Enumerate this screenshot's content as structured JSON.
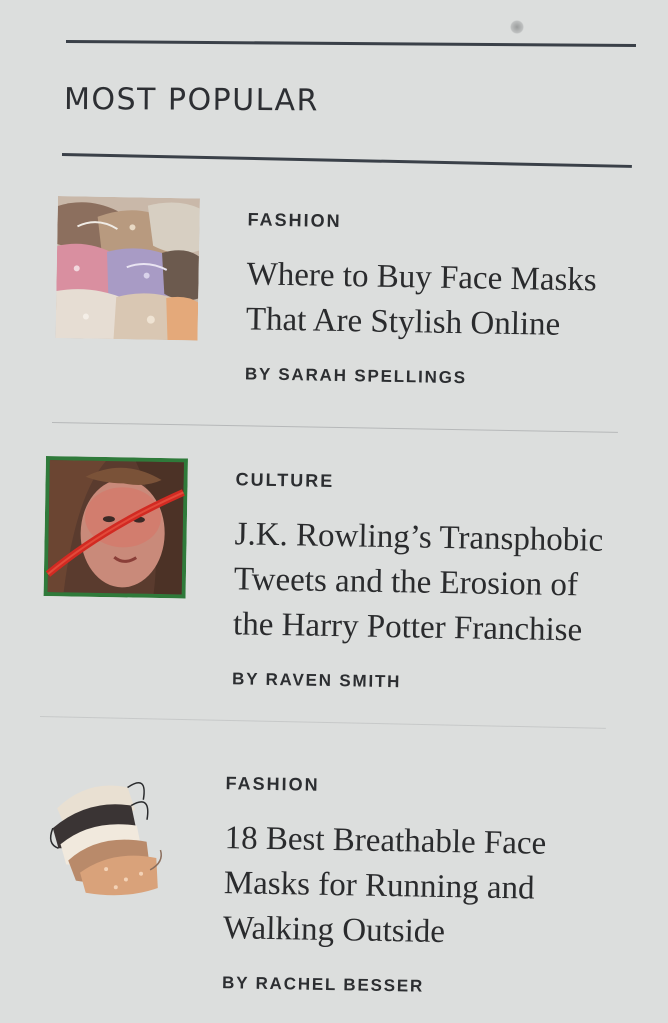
{
  "section": {
    "title": "MOST POPULAR"
  },
  "articles": [
    {
      "category": "FASHION",
      "headline": "Where to Buy Face Masks That Are Stylish Online",
      "byline": "BY SARAH SPELLINGS",
      "thumbnail_icon": "fabric-face-masks-pile-image"
    },
    {
      "category": "CULTURE",
      "headline": "J.K. Rowling’s Transphobic Tweets and the Erosion of the Harry Potter Franchise",
      "byline": "BY RAVEN SMITH",
      "thumbnail_icon": "portrait-with-red-slash-image"
    },
    {
      "category": "FASHION",
      "headline": "18 Best Breathable Face Masks for Running and Walking Outside",
      "byline": "BY RACHEL BESSER",
      "thumbnail_icon": "stacked-face-masks-image"
    }
  ],
  "colors": {
    "background": "#dcdedd",
    "text": "#2a2b2d",
    "rule": "#3a4048",
    "accent_red": "#d22a22",
    "accent_green": "#2e7d32"
  }
}
